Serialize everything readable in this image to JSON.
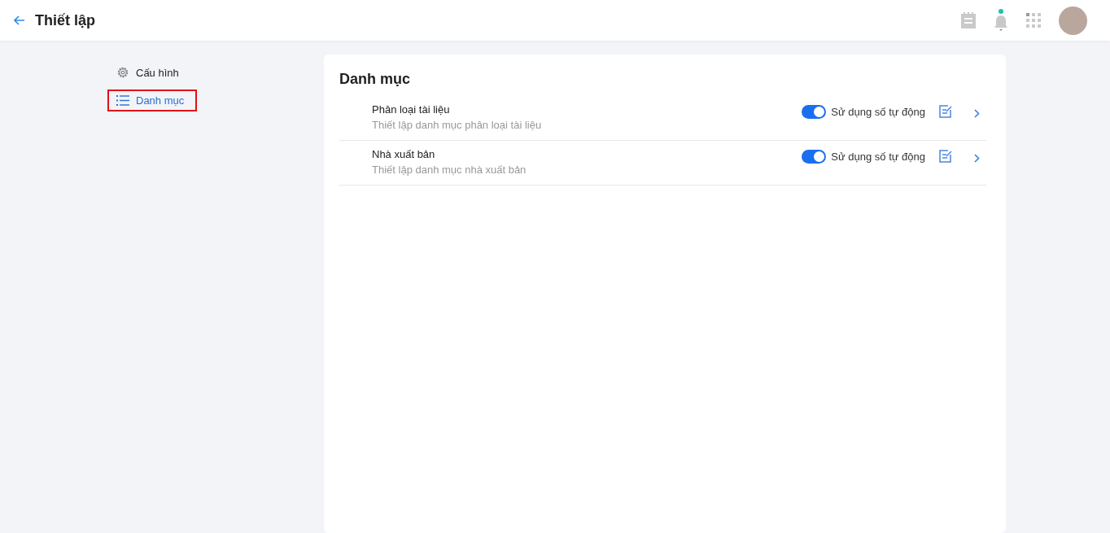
{
  "header": {
    "title": "Thiết lập",
    "notification_dot": true
  },
  "sidebar": {
    "items": [
      {
        "label": "Cấu hình",
        "kind": "gear",
        "selected": false
      },
      {
        "label": "Danh mục",
        "kind": "list",
        "selected": true
      }
    ]
  },
  "panel": {
    "title": "Danh mục",
    "rows": [
      {
        "title": "Phân loại tài liệu",
        "description": "Thiết lập danh mục phân loại tài liệu",
        "toggle_label": "Sử dụng số tự động",
        "on": true
      },
      {
        "title": "Nhà xuất bản",
        "description": "Thiết lập danh mục nhà xuất bản",
        "toggle_label": "Sử dụng số tự động",
        "on": true
      }
    ]
  }
}
